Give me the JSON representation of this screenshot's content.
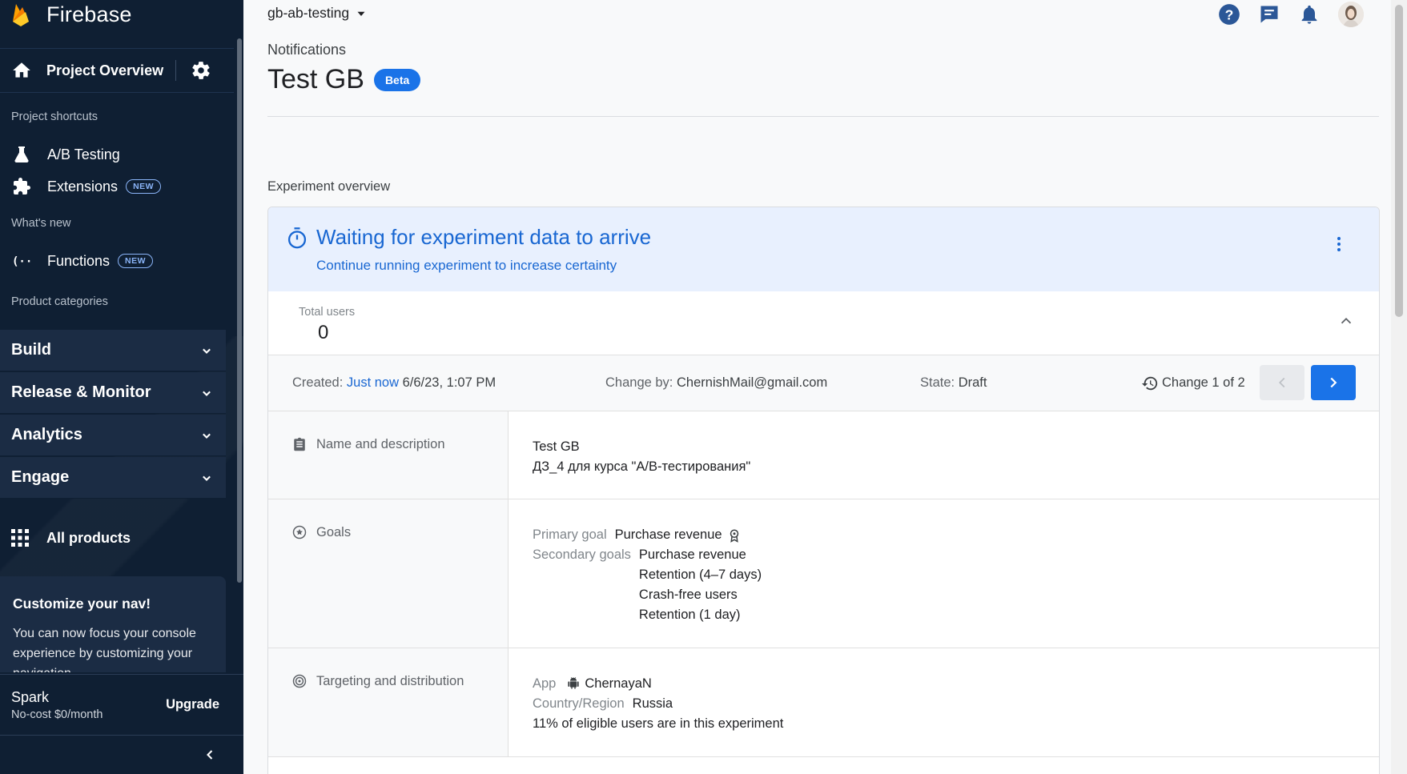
{
  "sidebar": {
    "brand": "Firebase",
    "project_overview": "Project Overview",
    "shortcuts_head": "Project shortcuts",
    "shortcuts": [
      {
        "label": "A/B Testing",
        "badge": ""
      },
      {
        "label": "Extensions",
        "badge": "NEW"
      }
    ],
    "whats_new_head": "What's new",
    "whats_new": [
      {
        "label": "Functions",
        "badge": "NEW"
      }
    ],
    "categories_head": "Product categories",
    "categories": [
      "Build",
      "Release & Monitor",
      "Analytics",
      "Engage"
    ],
    "all_products": "All products",
    "customize_title": "Customize your nav!",
    "customize_text": "You can now focus your console experience by customizing your navigation",
    "plan_name": "Spark",
    "plan_cost": "No-cost $0/month",
    "upgrade": "Upgrade"
  },
  "header": {
    "project": "gb-ab-testing",
    "breadcrumb": "Notifications",
    "title": "Test GB",
    "badge": "Beta"
  },
  "overview": {
    "section_label": "Experiment overview",
    "banner_title": "Waiting for experiment data to arrive",
    "banner_subtitle": "Continue running experiment to increase certainty",
    "total_users_label": "Total users",
    "total_users_value": "0",
    "created_label": "Created:",
    "created_link": "Just now",
    "created_date": "6/6/23, 1:07 PM",
    "change_by_label": "Change by:",
    "change_by_value": "ChernishMail@gmail.com",
    "state_label": "State:",
    "state_value": "Draft",
    "change_counter": "Change 1 of 2"
  },
  "rows": {
    "name": {
      "label": "Name and description",
      "title": "Test GB",
      "description": "ДЗ_4 для курса \"А/В-тестирования\""
    },
    "goals": {
      "label": "Goals",
      "primary_label": "Primary goal",
      "primary_value": "Purchase revenue",
      "secondary_label": "Secondary goals",
      "secondary": [
        "Purchase revenue",
        "Retention (4–7 days)",
        "Crash-free users",
        "Retention (1 day)"
      ]
    },
    "targeting": {
      "label": "Targeting and distribution",
      "app_label": "App",
      "app_value": "ChernayaN",
      "country_label": "Country/Region",
      "country_value": "Russia",
      "eligible": "11% of eligible users are in this experiment"
    }
  },
  "colors": {
    "sidebar_bg": "#0f1f33",
    "accent": "#1a73e8",
    "banner_bg": "#e8f0fe",
    "banner_text": "#1967d2"
  }
}
